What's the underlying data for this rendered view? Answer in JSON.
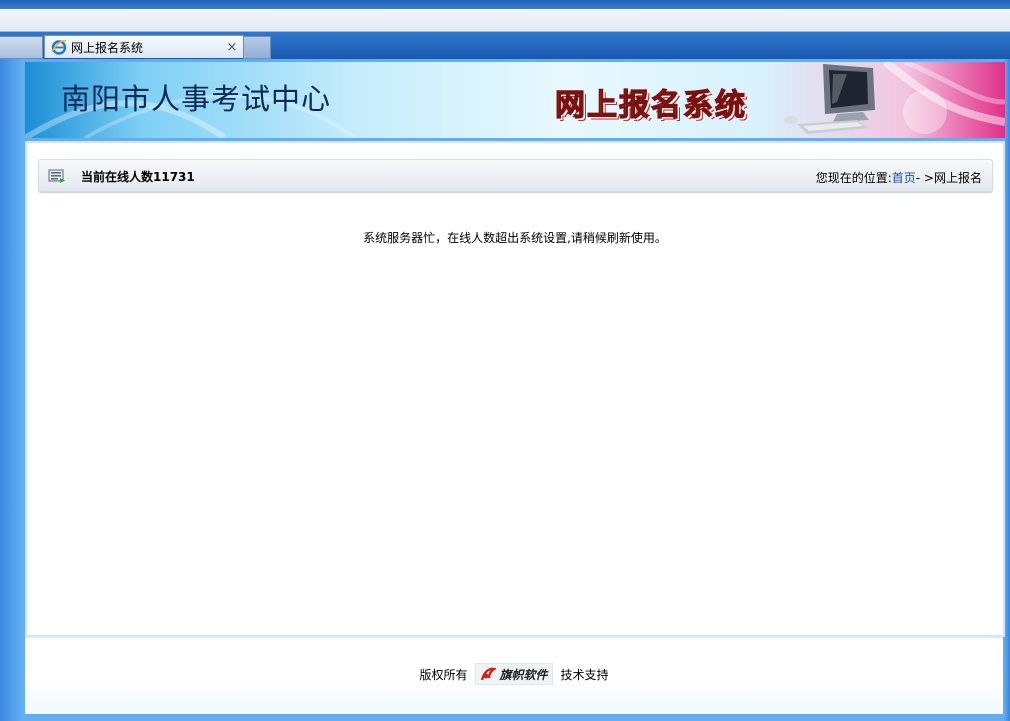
{
  "browser": {
    "tab_title": "网上报名系统",
    "close_symbol": "×"
  },
  "banner": {
    "org_name": "南阳市人事考试中心",
    "system_title": "网上报名系统"
  },
  "header": {
    "online_label": "当前在线人数11731",
    "location_prefix": "您现在的位置:",
    "location_home": "首页",
    "location_separator": "- >",
    "location_current": "网上报名"
  },
  "main": {
    "message": "系统服务器忙，在线人数超出系统设置,请稍候刷新使用。"
  },
  "footer": {
    "copyright": "版权所有",
    "logo_text": "旗帜软件",
    "support": "技术支持"
  },
  "colors": {
    "page_blue": "#62aef2",
    "banner_text": "#0b2a55",
    "title_orange": "#f2a01a",
    "link_blue": "#1a4fa3"
  }
}
